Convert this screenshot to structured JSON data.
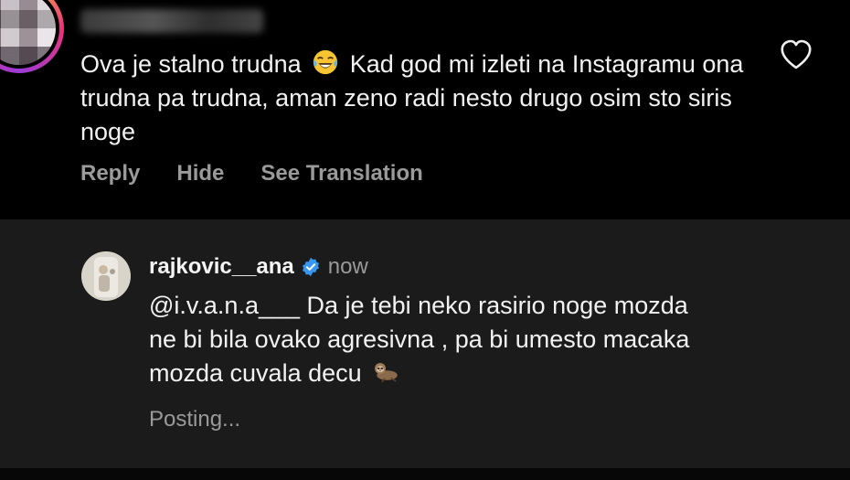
{
  "parent_comment": {
    "text_part1": "Ova je stalno trudna",
    "text_part2": "Kad god mi izleti na Instagramu ona trudna pa trudna, aman zeno radi nesto drugo osim sto siris noge",
    "emoji_icon": "face-with-tears-of-joy-icon",
    "actions": {
      "reply": "Reply",
      "hide": "Hide",
      "translate": "See Translation"
    },
    "like_icon": "heart-outline-icon"
  },
  "reply_comment": {
    "username": "rajkovic__ana",
    "verified_icon": "verified-badge-icon",
    "time": "now",
    "mention": "@i.v.a.n.a___",
    "text_part1": "Da je tebi neko rasirio noge mozda ne bi bila ovako agresivna , pa bi umesto macaka mozda cuvala decu",
    "emoji_icon": "sloth-icon",
    "status": "Posting..."
  },
  "colors": {
    "background": "#000000",
    "reply_background": "#1b1b1b",
    "secondary_text": "#9a9a9a",
    "verified_blue": "#3797f0"
  }
}
